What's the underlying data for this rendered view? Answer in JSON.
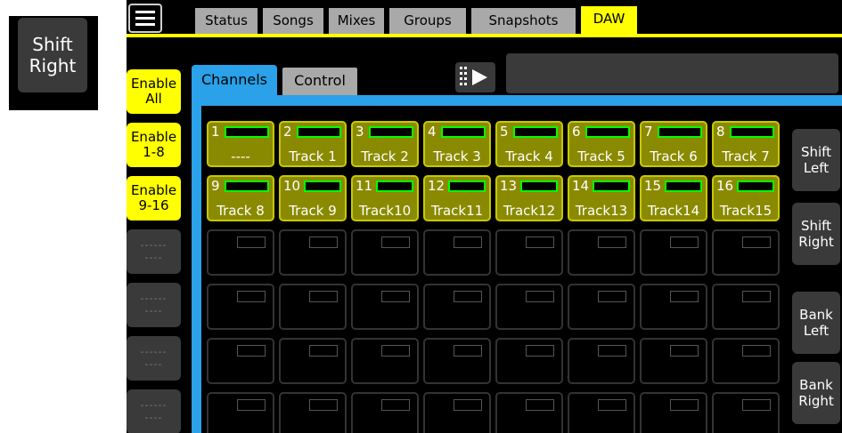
{
  "zoom_button": {
    "line1": "Shift",
    "line2": "Right"
  },
  "tabs": [
    {
      "label": "Status",
      "active": false
    },
    {
      "label": "Songs",
      "active": false
    },
    {
      "label": "Mixes",
      "active": false
    },
    {
      "label": "Groups",
      "active": false
    },
    {
      "label": "Snapshots",
      "active": false
    },
    {
      "label": "DAW",
      "active": true
    }
  ],
  "sub_tabs": [
    {
      "label": "Channels",
      "active": true
    },
    {
      "label": "Control",
      "active": false
    }
  ],
  "left_buttons": [
    {
      "line1": "Enable",
      "line2": "All",
      "enabled": true
    },
    {
      "line1": "Enable",
      "line2": "1-8",
      "enabled": true
    },
    {
      "line1": "Enable",
      "line2": "9-16",
      "enabled": true
    },
    {
      "line1": "------",
      "line2": "----",
      "enabled": false
    },
    {
      "line1": "------",
      "line2": "----",
      "enabled": false
    },
    {
      "line1": "------",
      "line2": "----",
      "enabled": false
    },
    {
      "line1": "------",
      "line2": "----",
      "enabled": false
    }
  ],
  "right_buttons": [
    {
      "line1": "Shift",
      "line2": "Left"
    },
    {
      "line1": "Shift",
      "line2": "Right"
    },
    {
      "line1": "Bank",
      "line2": "Left"
    },
    {
      "line1": "Bank",
      "line2": "Right"
    }
  ],
  "channels": [
    {
      "num": "1",
      "name": "----"
    },
    {
      "num": "2",
      "name": "Track 1"
    },
    {
      "num": "3",
      "name": "Track 2"
    },
    {
      "num": "4",
      "name": "Track 3"
    },
    {
      "num": "5",
      "name": "Track 4"
    },
    {
      "num": "6",
      "name": "Track 5"
    },
    {
      "num": "7",
      "name": "Track 6"
    },
    {
      "num": "8",
      "name": "Track 7"
    },
    {
      "num": "9",
      "name": "Track 8"
    },
    {
      "num": "10",
      "name": "Track 9"
    },
    {
      "num": "11",
      "name": "Track10"
    },
    {
      "num": "12",
      "name": "Track11"
    },
    {
      "num": "13",
      "name": "Track12"
    },
    {
      "num": "14",
      "name": "Track13"
    },
    {
      "num": "15",
      "name": "Track14"
    },
    {
      "num": "16",
      "name": "Track15"
    }
  ],
  "empty_rows": 4,
  "colors": {
    "accent_yellow": "#ffff00",
    "accent_blue": "#2aa1e8",
    "button_gray": "#3a3a3a",
    "tab_gray": "#a9a9a9"
  }
}
